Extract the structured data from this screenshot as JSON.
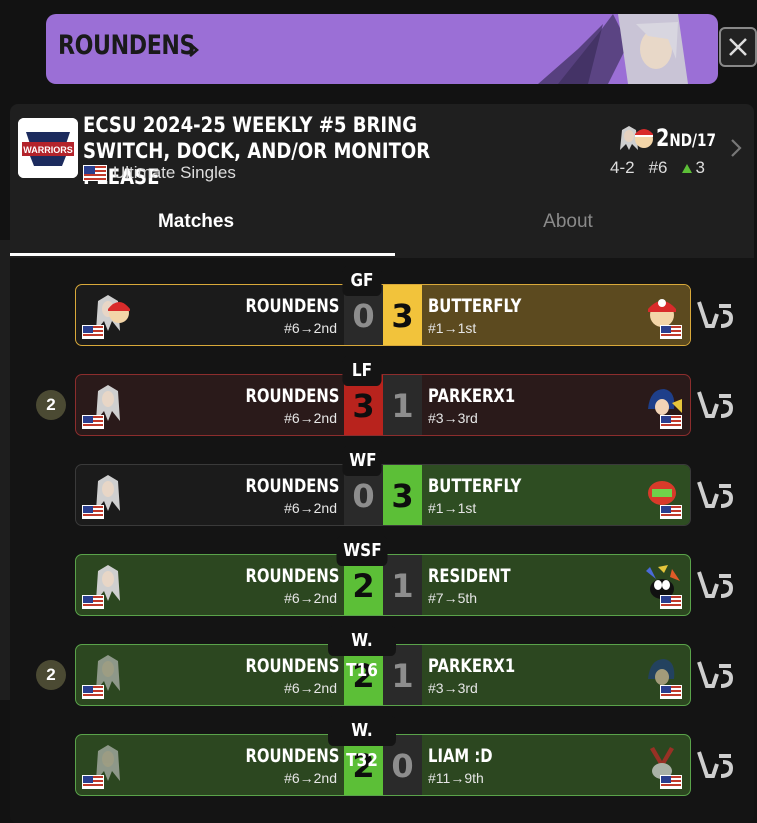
{
  "banner": {
    "player_name": "ROUNDENS",
    "chevron": "chevron-right-icon"
  },
  "close": {
    "icon": "close-icon"
  },
  "event": {
    "title": "ECSU 2024-25 WEEKLY #5 BRING SWITCH, DOCK, AND/OR MONITOR PLEASE",
    "subtitle": "Ultimate Singles",
    "logo_text": "WARRIORS",
    "placement": "2",
    "placement_suffix": "ND",
    "placement_total": "/17",
    "record": "4-2",
    "seed": "#6",
    "delta": "3"
  },
  "tabs": {
    "matches": "Matches",
    "about": "About"
  },
  "matches": [
    {
      "round": "GF",
      "left_name": "ROUNDENS",
      "left_seed": "#6→2nd",
      "left_score": "0",
      "right_score": "3",
      "right_name": "BUTTERFLY",
      "right_seed": "#1→1st",
      "badge": ""
    },
    {
      "round": "LF",
      "left_name": "ROUNDENS",
      "left_seed": "#6→2nd",
      "left_score": "3",
      "right_score": "1",
      "right_name": "PARKERX1",
      "right_seed": "#3→3rd",
      "badge": "2"
    },
    {
      "round": "WF",
      "left_name": "ROUNDENS",
      "left_seed": "#6→2nd",
      "left_score": "0",
      "right_score": "3",
      "right_name": "BUTTERFLY",
      "right_seed": "#1→1st",
      "badge": ""
    },
    {
      "round": "WSF",
      "left_name": "ROUNDENS",
      "left_seed": "#6→2nd",
      "left_score": "2",
      "right_score": "1",
      "right_name": "RESIDENT",
      "right_seed": "#7→5th",
      "badge": ""
    },
    {
      "round": "W. T16",
      "left_name": "ROUNDENS",
      "left_seed": "#6→2nd",
      "left_score": "2",
      "right_score": "1",
      "right_name": "PARKERX1",
      "right_seed": "#3→3rd",
      "badge": "2"
    },
    {
      "round": "W. T32",
      "left_name": "ROUNDENS",
      "left_seed": "#6→2nd",
      "left_score": "2",
      "right_score": "0",
      "right_name": "LIAM :D",
      "right_seed": "#11→9th",
      "badge": ""
    }
  ],
  "colors": {
    "banner": "#9b6fd6",
    "win": "#5cbf37",
    "loss": "#b8231d",
    "gold": "#f2c33b"
  }
}
